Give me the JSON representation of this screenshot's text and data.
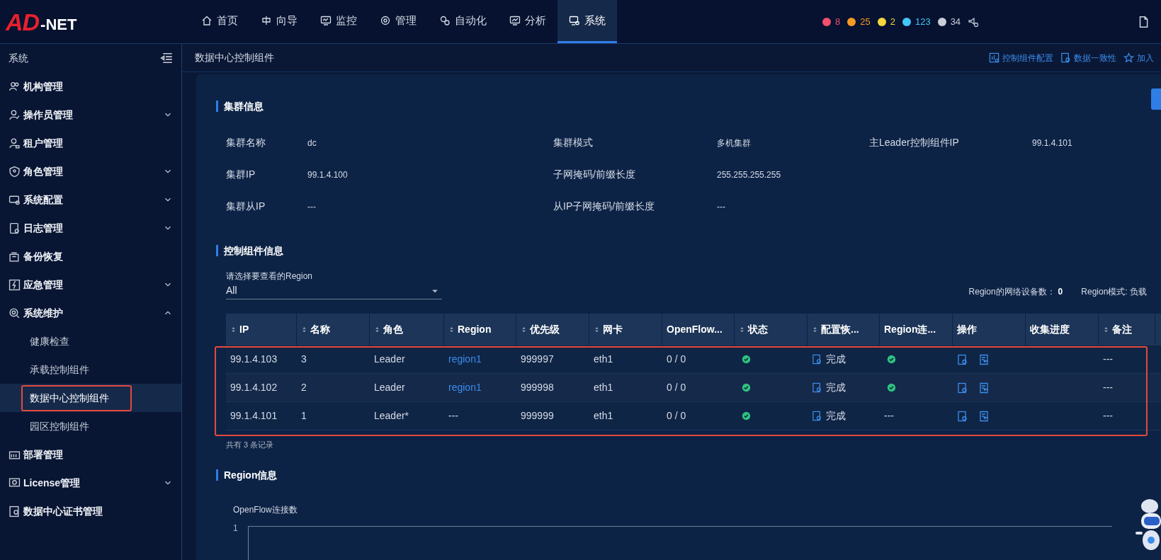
{
  "logo": {
    "mark": "AD",
    "suffix": "-NET"
  },
  "nav": [
    {
      "label": "首页",
      "selected": false
    },
    {
      "label": "向导",
      "selected": false
    },
    {
      "label": "监控",
      "selected": false
    },
    {
      "label": "管理",
      "selected": false
    },
    {
      "label": "自动化",
      "selected": false
    },
    {
      "label": "分析",
      "selected": false
    },
    {
      "label": "系统",
      "selected": true
    }
  ],
  "alerts": [
    {
      "count": "8",
      "color": "#f0506e"
    },
    {
      "count": "25",
      "color": "#f59a23"
    },
    {
      "count": "2",
      "color": "#f5d63d"
    },
    {
      "count": "123",
      "color": "#43c6f5"
    },
    {
      "count": "34",
      "color": "#c9ced8"
    }
  ],
  "sidebar": {
    "title": "系统",
    "items": [
      {
        "label": "机构管理"
      },
      {
        "label": "操作员管理",
        "expanded": false
      },
      {
        "label": "租户管理"
      },
      {
        "label": "角色管理",
        "expanded": false
      },
      {
        "label": "系统配置",
        "expanded": false
      },
      {
        "label": "日志管理",
        "expanded": false
      },
      {
        "label": "备份恢复"
      },
      {
        "label": "应急管理",
        "expanded": false
      },
      {
        "label": "系统维护",
        "expanded": true,
        "children": [
          {
            "label": "健康检查",
            "selected": false
          },
          {
            "label": "承载控制组件",
            "selected": false
          },
          {
            "label": "数据中心控制组件",
            "selected": true,
            "highlighted": true
          },
          {
            "label": "园区控制组件",
            "selected": false
          }
        ]
      },
      {
        "label": "部署管理"
      },
      {
        "label": "License管理",
        "expanded": false
      },
      {
        "label": "数据中心证书管理"
      }
    ]
  },
  "page": {
    "title": "数据中心控制组件",
    "actions": [
      "控制组件配置",
      "数据一致性",
      "加入"
    ]
  },
  "cluster_info": {
    "title": "集群信息",
    "fields": [
      [
        {
          "label": "集群名称",
          "value": "dc"
        },
        {
          "label": "集群模式",
          "value": "多机集群"
        },
        {
          "label": "主Leader控制组件IP",
          "value": "99.1.4.101"
        }
      ],
      [
        {
          "label": "集群IP",
          "value": "99.1.4.100"
        },
        {
          "label": "子网掩码/前缀长度",
          "value": "255.255.255.255"
        }
      ],
      [
        {
          "label": "集群从IP",
          "value": "---"
        },
        {
          "label": "从IP子网掩码/前缀长度",
          "value": "---"
        }
      ]
    ]
  },
  "controller_info": {
    "title": "控制组件信息",
    "region_select": {
      "label": "请选择要查看的Region",
      "value": "All"
    },
    "summary": [
      {
        "label": "Region的网络设备数：",
        "value": "0"
      },
      {
        "label": "Region模式: 负载"
      }
    ],
    "table": {
      "rows_highlighted": true,
      "columns": [
        {
          "label": "IP",
          "sortable": true
        },
        {
          "label": "名称",
          "sortable": true
        },
        {
          "label": "角色",
          "sortable": true
        },
        {
          "label": "Region",
          "sortable": true
        },
        {
          "label": "优先级",
          "sortable": true
        },
        {
          "label": "网卡",
          "sortable": true
        },
        {
          "label": "OpenFlow...",
          "sortable": false
        },
        {
          "label": "状态",
          "sortable": true
        },
        {
          "label": "配置恢...",
          "sortable": true
        },
        {
          "label": "Region连...",
          "sortable": false
        },
        {
          "label": "操作",
          "sortable": false
        },
        {
          "label": "收集进度",
          "sortable": false
        },
        {
          "label": "备注",
          "sortable": true
        }
      ],
      "rows": [
        [
          {
            "kind": "text",
            "text": "99.1.4.103"
          },
          {
            "kind": "text",
            "text": "3"
          },
          {
            "kind": "text",
            "text": "Leader"
          },
          {
            "kind": "link",
            "text": "region1"
          },
          {
            "kind": "text",
            "text": "999997"
          },
          {
            "kind": "text",
            "text": "eth1"
          },
          {
            "kind": "text",
            "text": "0 / 0"
          },
          {
            "kind": "ok"
          },
          {
            "kind": "config",
            "text": "完成"
          },
          {
            "kind": "ok"
          },
          {
            "kind": "actions"
          },
          {
            "kind": "empty"
          },
          {
            "kind": "text",
            "text": "---"
          }
        ],
        [
          {
            "kind": "text",
            "text": "99.1.4.102"
          },
          {
            "kind": "text",
            "text": "2"
          },
          {
            "kind": "text",
            "text": "Leader"
          },
          {
            "kind": "link",
            "text": "region1"
          },
          {
            "kind": "text",
            "text": "999998"
          },
          {
            "kind": "text",
            "text": "eth1"
          },
          {
            "kind": "text",
            "text": "0 / 0"
          },
          {
            "kind": "ok"
          },
          {
            "kind": "config",
            "text": "完成"
          },
          {
            "kind": "ok"
          },
          {
            "kind": "actions"
          },
          {
            "kind": "empty"
          },
          {
            "kind": "text",
            "text": "---"
          }
        ],
        [
          {
            "kind": "text",
            "text": "99.1.4.101"
          },
          {
            "kind": "text",
            "text": "1"
          },
          {
            "kind": "text",
            "text": "Leader*"
          },
          {
            "kind": "text",
            "text": "---"
          },
          {
            "kind": "text",
            "text": "999999"
          },
          {
            "kind": "text",
            "text": "eth1"
          },
          {
            "kind": "text",
            "text": "0 / 0"
          },
          {
            "kind": "ok"
          },
          {
            "kind": "config",
            "text": "完成"
          },
          {
            "kind": "text",
            "text": "---"
          },
          {
            "kind": "actions"
          },
          {
            "kind": "empty"
          },
          {
            "kind": "text",
            "text": "---"
          }
        ]
      ],
      "footer": "共有 3 条记录"
    }
  },
  "region_info": {
    "title": "Region信息",
    "chart_title": "OpenFlow连接数",
    "axis_label": "1"
  }
}
